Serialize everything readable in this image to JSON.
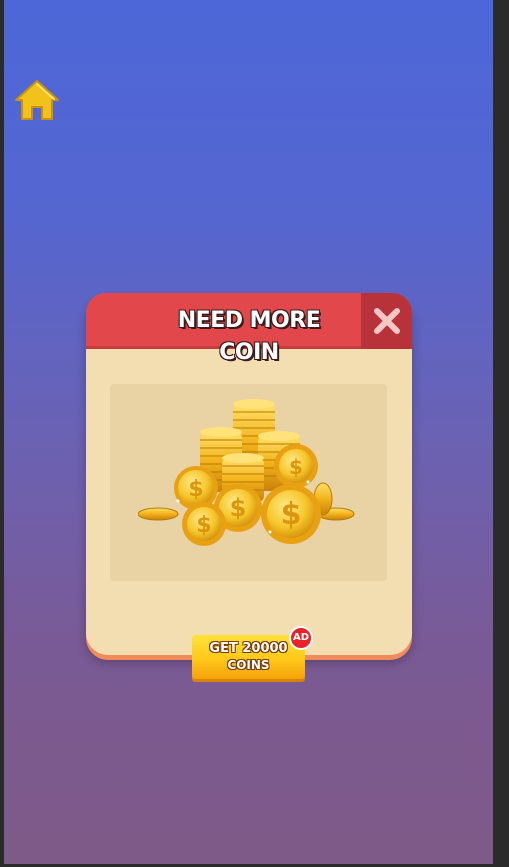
{
  "dialog": {
    "title": "NEED MORE COIN",
    "close_icon": "close-x-icon"
  },
  "home": {
    "icon": "home-icon",
    "color": "#f2c21b"
  },
  "reward_button": {
    "line1": "GET 20000",
    "line2": "COINS",
    "badge": "AD"
  },
  "colors": {
    "header": "#e2484b",
    "close_button": "#b8323a",
    "dialog_body": "#f2deb1",
    "button": "#ffc81a",
    "badge": "#e8222a"
  },
  "illustration": {
    "icon": "coin-stack-icon"
  }
}
